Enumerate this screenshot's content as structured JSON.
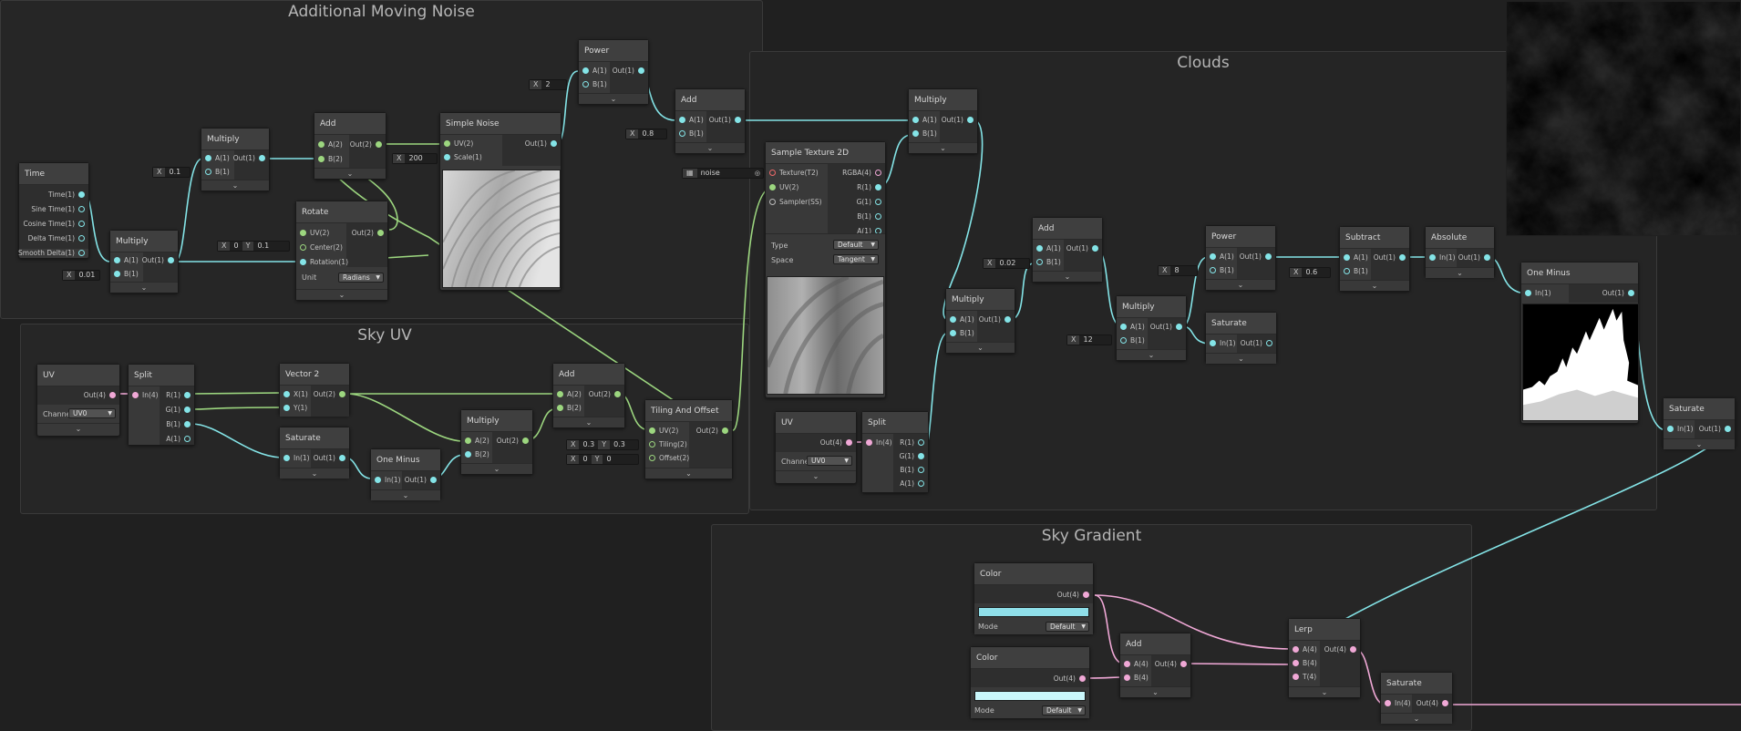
{
  "groups": {
    "additional_moving_noise": "Additional Moving Noise",
    "clouds": "Clouds",
    "sky_uv": "Sky UV",
    "sky_gradient": "Sky Gradient"
  },
  "nodes": {
    "time": {
      "title": "Time",
      "outputs": [
        "Time(1)",
        "Sine Time(1)",
        "Cosine Time(1)",
        "Delta Time(1)",
        "Smooth Delta(1)"
      ]
    },
    "multiply": "Multiply",
    "add": "Add",
    "power": "Power",
    "rotate": "Rotate",
    "simple_noise": "Simple Noise",
    "sample_texture": "Sample Texture 2D",
    "saturate": "Saturate",
    "subtract": "Subtract",
    "absolute": "Absolute",
    "one_minus": "One Minus",
    "uv": "UV",
    "split": "Split",
    "vector2": "Vector 2",
    "tiling_offset": "Tiling And Offset",
    "color": "Color",
    "lerp": "Lerp"
  },
  "ports": {
    "a1": "A(1)",
    "b1": "B(1)",
    "out1": "Out(1)",
    "a2": "A(2)",
    "b2": "B(2)",
    "out2": "Out(2)",
    "uv2": "UV(2)",
    "scale1": "Scale(1)",
    "center2": "Center(2)",
    "rotation1": "Rotation(1)",
    "in1": "In(1)",
    "in4": "In(4)",
    "out4": "Out(4)",
    "a4": "A(4)",
    "b4": "B(4)",
    "t4": "T(4)",
    "r1": "R(1)",
    "g1": "G(1)",
    "b_1": "B(1)",
    "alpha1": "A(1)",
    "x1": "X(1)",
    "y1": "Y(1)",
    "tiling2": "Tiling(2)",
    "offset2": "Offset(2)",
    "texture2": "Texture(T2)",
    "sampler": "Sampler(SS)",
    "rgba4": "RGBA(4)"
  },
  "params": {
    "x": "X",
    "y": "Y",
    "power_b": "2",
    "noise_speed": "0.1",
    "time_mult": "0.01",
    "center_x": "0",
    "center_y": "0.1",
    "noise_scale": "200",
    "add_b": "0.8",
    "texture_name": "noise",
    "clouds_add_b": "0.02",
    "clouds_mult_b": "12",
    "power2_b": "8",
    "subtract_b": "0.6",
    "tiling_x": "0.3",
    "tiling_y": "0.3",
    "offset_x": "0",
    "offset_y": "0"
  },
  "props": {
    "unit_label": "Unit",
    "unit_value": "Radians",
    "type_label": "Type",
    "type_value": "Default",
    "space_label": "Space",
    "space_value": "Tangent",
    "channel_label": "Channel",
    "channel_value": "UV0",
    "mode_label": "Mode",
    "mode_value": "Default"
  },
  "colors": {
    "vector1": "#84e4e7",
    "vector2": "#9cd67f",
    "vector4": "#f0a8d6",
    "texture": "#f06a6a",
    "color_top": "#8fdfe9",
    "color_bottom": "#c9f7fb"
  },
  "icons": {
    "collapse": "chevron-down-icon",
    "dropdown": "caret-down-icon",
    "texture": "texture-icon",
    "target": "target-icon"
  }
}
